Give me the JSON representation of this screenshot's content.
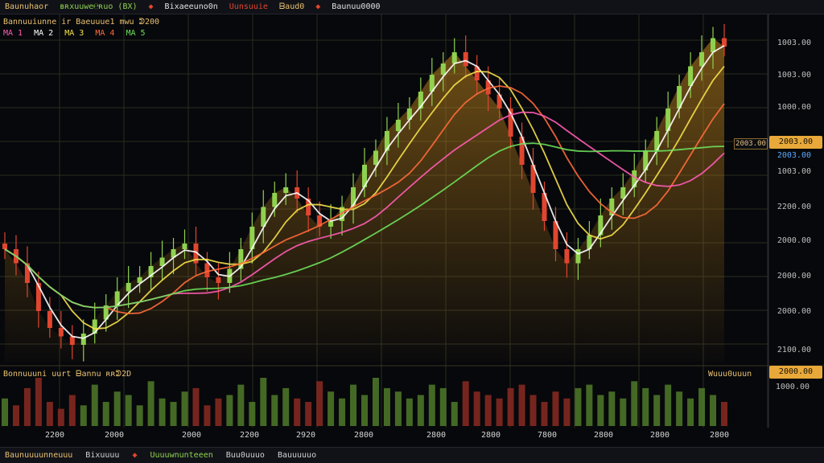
{
  "topbar": {
    "symbol": "Baunuhaor",
    "indicators": "ʙʀxuuwe℮ʀuo (BX)",
    "pair": "Bixaeeuno0n",
    "ma_a": "Uunsuuie",
    "ma_b": "ᗷaud0",
    "ref": "Baunuu0000"
  },
  "legend": {
    "line1": "Bannuuiunne ir Baeuuue1 mwu ᕲ200",
    "ma_labels": [
      "MA 1",
      "MA 2",
      "MA 3",
      "MA 4",
      "MA 5"
    ]
  },
  "price_axis": {
    "labels": [
      "1003.00",
      "1003.00",
      "1000.00",
      "1003.00",
      "2200.00",
      "2000.00",
      "2000.00",
      "2000.00",
      "2100.00"
    ],
    "current_price": "2003.00",
    "ref_price": "2003.00",
    "below_current": "2003.00"
  },
  "volume": {
    "legend": "Bonnuuuni uurt  ᗷannu ʀʀᕲ2D",
    "right_label": "Wuuu0uuun",
    "value_tag": "2000.00",
    "axis_label": "1000.00"
  },
  "time_axis": {
    "labels": [
      "2200",
      "2000",
      "2000",
      "2200",
      "2920",
      "2800",
      "2800",
      "2800",
      "7800",
      "2800",
      "2800",
      "2800"
    ]
  },
  "bottombar": {
    "items": [
      "Baunuuuunneuuu",
      "Bixuuuu",
      "Uuuuwnunteeen",
      "Buu0uuuo",
      "Bauuuuuo"
    ]
  },
  "colors": {
    "bg": "#07080b",
    "grid": "#2a2c1f",
    "up": "#8fd14f",
    "down": "#e0462f",
    "ma1": "#ff5cb4",
    "ma2": "#ffffff",
    "ma3": "#f4e04a",
    "ma4": "#ff6a3a",
    "ma5": "#6ee05a",
    "accent": "#e8a93a"
  },
  "chart_data": {
    "type": "line",
    "candles_close": [
      2300,
      2250,
      2180,
      2080,
      2020,
      1990,
      1960,
      2000,
      2050,
      2100,
      2150,
      2180,
      2200,
      2240,
      2270,
      2300,
      2320,
      2250,
      2200,
      2180,
      2230,
      2300,
      2380,
      2450,
      2500,
      2520,
      2480,
      2420,
      2380,
      2400,
      2450,
      2520,
      2600,
      2650,
      2720,
      2760,
      2800,
      2860,
      2920,
      2960,
      3000,
      2950,
      2900,
      2850,
      2800,
      2700,
      2600,
      2500,
      2400,
      2300,
      2250,
      2300,
      2350,
      2420,
      2480,
      2520,
      2580,
      2650,
      2720,
      2800,
      2880,
      2950,
      3000,
      3050,
      3020
    ],
    "volume": [
      40,
      30,
      55,
      70,
      35,
      25,
      45,
      30,
      60,
      35,
      50,
      45,
      30,
      65,
      40,
      35,
      50,
      55,
      30,
      40,
      45,
      60,
      35,
      70,
      45,
      55,
      40,
      35,
      65,
      50,
      40,
      60,
      45,
      70,
      55,
      50,
      40,
      45,
      60,
      55,
      35,
      65,
      50,
      45,
      40,
      55,
      60,
      45,
      35,
      50,
      40,
      55,
      60,
      45,
      50,
      40,
      65,
      55,
      45,
      60,
      50,
      40,
      55,
      45,
      35
    ]
  }
}
